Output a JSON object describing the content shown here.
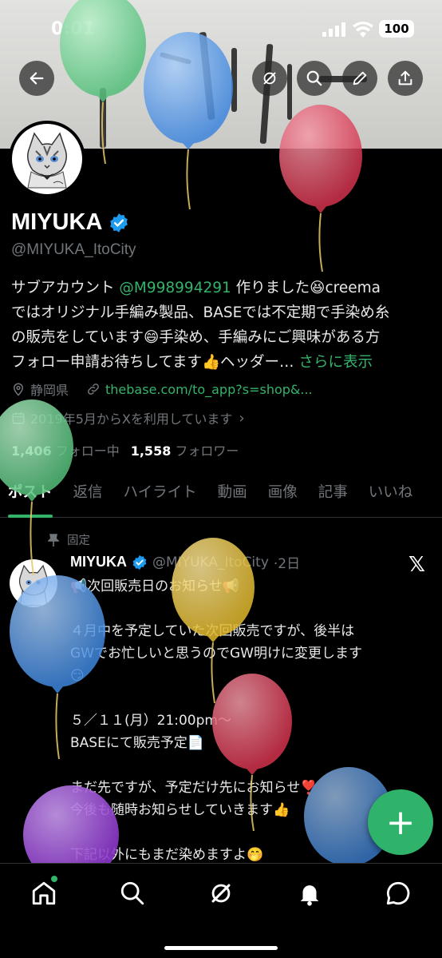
{
  "status_bar": {
    "time": "0:01",
    "battery": "100"
  },
  "profile": {
    "display_name": "MIYUKA",
    "handle": "@MIYUKA_ItoCity",
    "bio": {
      "prefix": "サブアカウント ",
      "mention": "@M998994291",
      "line1_rest": " 作りました😆creema",
      "line2": "ではオリジナル手編み製品、BASEでは不定期で手染め糸",
      "line3": "の販売をしています😄手染め、手編みにご興味がある方",
      "line4": "フォロー申請お待ちしてます👍ヘッダー…",
      "more": " さらに表示"
    },
    "location": "静岡県",
    "website": "thebase.com/to_app?s=shop&...",
    "joined": "2019年5月からXを利用しています",
    "following_count": "1,406",
    "following_label": "フォロー中",
    "followers_count": "1,558",
    "followers_label": "フォロワー"
  },
  "tabs": [
    "ポスト",
    "返信",
    "ハイライト",
    "動画",
    "画像",
    "記事",
    "いいね"
  ],
  "post": {
    "pinned_label": "固定",
    "author": "MIYUKA",
    "handle": "@MIYUKA_ItoCity",
    "time": "·2日",
    "lines": [
      "📢次回販売日のお知らせ📢",
      "",
      "４月中を予定していた次回販売ですが、後半は",
      "GWでお忙しいと思うのでGW明けに変更します",
      "😏",
      "",
      "５／１１(月）21:00pm〜",
      "BASEにて販売予定📄",
      "",
      "まだ先ですが、予定だけ先にお知らせ❣️",
      "今後も随時お知らせしていきます👍",
      "",
      "下記以外にもまだ染めますよ🤭"
    ]
  },
  "fab": {
    "label": "+"
  },
  "colors": {
    "accent": "#34b36b",
    "muted": "#71767b",
    "background": "#000000"
  },
  "icons": {
    "header": [
      "back-icon",
      "grok-icon",
      "search-icon",
      "edit-icon",
      "share-icon"
    ],
    "nav": [
      "home-icon",
      "search-icon",
      "grok-icon",
      "notifications-icon",
      "messages-icon"
    ]
  }
}
